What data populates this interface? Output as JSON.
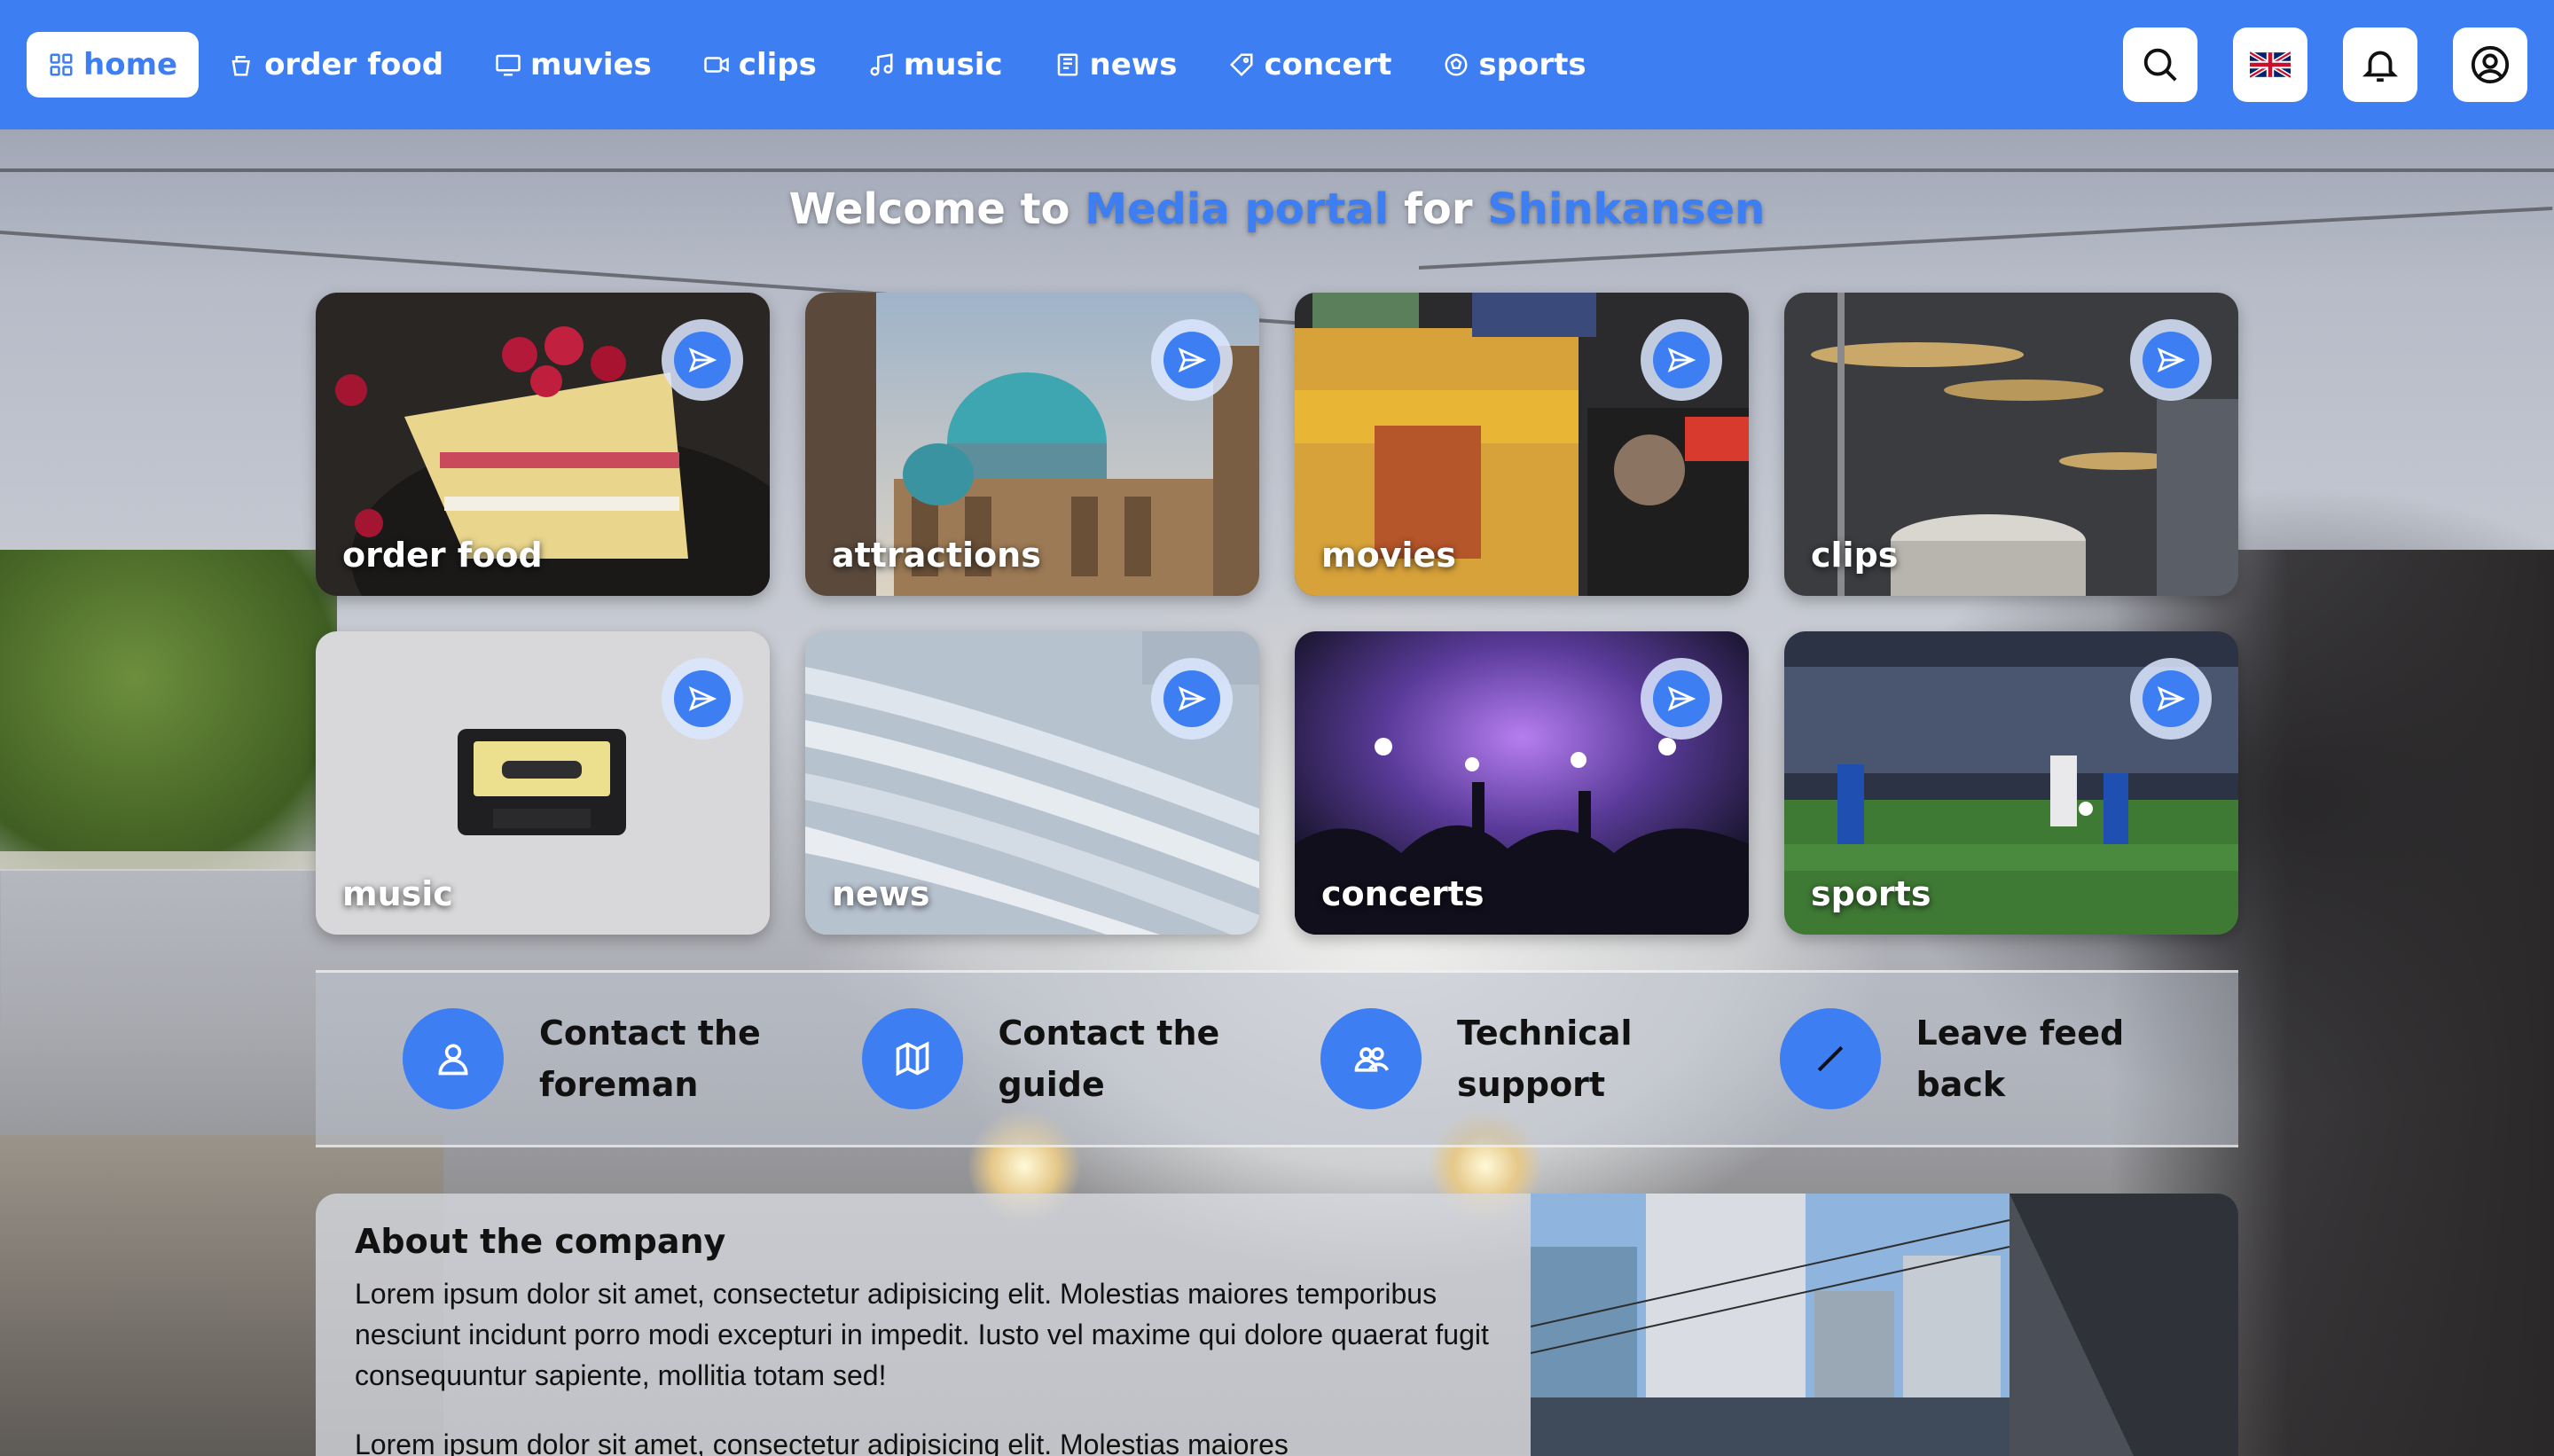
{
  "nav": {
    "items": [
      {
        "label": "home",
        "icon": "grid-icon",
        "active": true
      },
      {
        "label": "order food",
        "icon": "cup-icon",
        "active": false
      },
      {
        "label": "muvies",
        "icon": "monitor-icon",
        "active": false
      },
      {
        "label": "clips",
        "icon": "video-icon",
        "active": false
      },
      {
        "label": "music",
        "icon": "music-note-icon",
        "active": false
      },
      {
        "label": "news",
        "icon": "newspaper-icon",
        "active": false
      },
      {
        "label": "concert",
        "icon": "ticket-icon",
        "active": false
      },
      {
        "label": "sports",
        "icon": "ball-icon",
        "active": false
      }
    ],
    "right_buttons": [
      "search-icon",
      "uk-flag-icon",
      "bell-icon",
      "user-circle-icon"
    ]
  },
  "welcome": {
    "part1": "Welcome to ",
    "highlight1": "Media portal",
    "part2": " for ",
    "highlight2": "Shinkansen"
  },
  "cards": [
    {
      "label": "order food"
    },
    {
      "label": "attractions"
    },
    {
      "label": "movies"
    },
    {
      "label": "clips"
    },
    {
      "label": "music"
    },
    {
      "label": "news"
    },
    {
      "label": "concerts"
    },
    {
      "label": "sports"
    }
  ],
  "contacts": [
    {
      "label": "Contact the foreman",
      "icon": "person-icon"
    },
    {
      "label": "Contact the guide",
      "icon": "map-icon"
    },
    {
      "label": "Technical support",
      "icon": "people-icon"
    },
    {
      "label": "Leave feed back",
      "icon": "pencil-icon"
    }
  ],
  "about": {
    "title": "About the company",
    "paragraph1": "Lorem ipsum dolor sit amet, consectetur adipisicing elit. Molestias maiores temporibus nesciunt incidunt porro modi excepturi in impedit. Iusto vel maxime qui dolore quaerat fugit consequuntur sapiente, mollitia totam sed!",
    "paragraph2": "Lorem ipsum dolor sit amet, consectetur adipisicing elit. Molestias maiores"
  },
  "colors": {
    "accent": "#3d7ef3",
    "nav_text": "#ffffff"
  }
}
